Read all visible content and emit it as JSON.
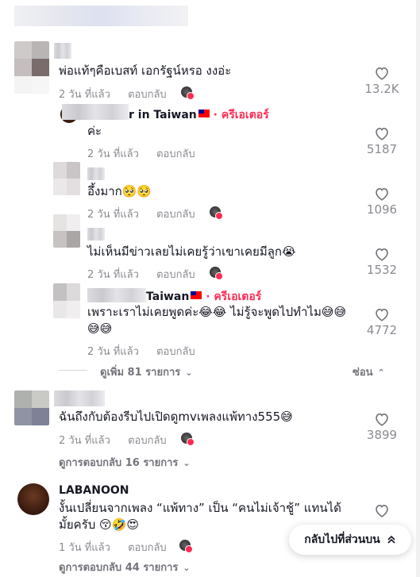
{
  "colors": {
    "accent": "#fe2c55",
    "text": "#161823",
    "muted": "#8a8b91"
  },
  "comments": [
    {
      "text": "พ่อแท้ๆคือเบสท์ เอกรัฐน์หรอ งงอ่ะ",
      "time": "2 วัน ที่แล้ว",
      "reply": "ตอบกลับ",
      "likes": "13.2K"
    },
    {
      "username_suffix": "r in Taiwan",
      "badge": "· ครีเอเตอร์",
      "text": "ค่ะ",
      "time": "2 วัน ที่แล้ว",
      "reply": "ตอบกลับ",
      "likes": "5187"
    },
    {
      "text": "อึ้งมาก🥺🥺",
      "time": "2 วัน ที่แล้ว",
      "reply": "ตอบกลับ",
      "likes": "1096"
    },
    {
      "text": "ไม่เห็นมีข่าวเลยไม่เคยรู้ว่าเขาเคยมีลูก😭",
      "time": "2 วัน ที่แล้ว",
      "reply": "ตอบกลับ",
      "likes": "1532"
    },
    {
      "username_suffix": "Taiwan",
      "badge": "· ครีเอเตอร์",
      "text": "เพราะเราไม่เคยพูดค่ะ😂😂 ไม่รู้จะพูดไปทำไม😅😅",
      "text2": "😅😅",
      "time": "2 วัน ที่แล้ว",
      "reply": "ตอบกลับ",
      "likes": "4772"
    },
    {
      "text": "ฉันถึงกับต้องรีบไปเปิดดูmvเพลงแพ้ทาง555😅",
      "time": "2 วัน ที่แล้ว",
      "reply": "ตอบกลับ",
      "likes": "3899"
    },
    {
      "username": "LABANOON",
      "text": "งั้นเปลี่ยนจากเพลง “แพ้ทาง” เป็น “คนไม่เจ้าชู้” แทนได้",
      "text2": "มั้ยครับ 😚🤣😍",
      "time": "1 วัน ที่แล้ว",
      "reply": "ตอบกลับ"
    }
  ],
  "more_replies": {
    "label": "ดูเพิ่ม 81 รายการ",
    "hide": "ซ่อน"
  },
  "view_replies_1": "ดูการตอบกลับ 16 รายการ",
  "view_replies_2": "ดูการตอบกลับ 44 รายการ",
  "back_to_top": "กลับไปที่ส่วนบน"
}
